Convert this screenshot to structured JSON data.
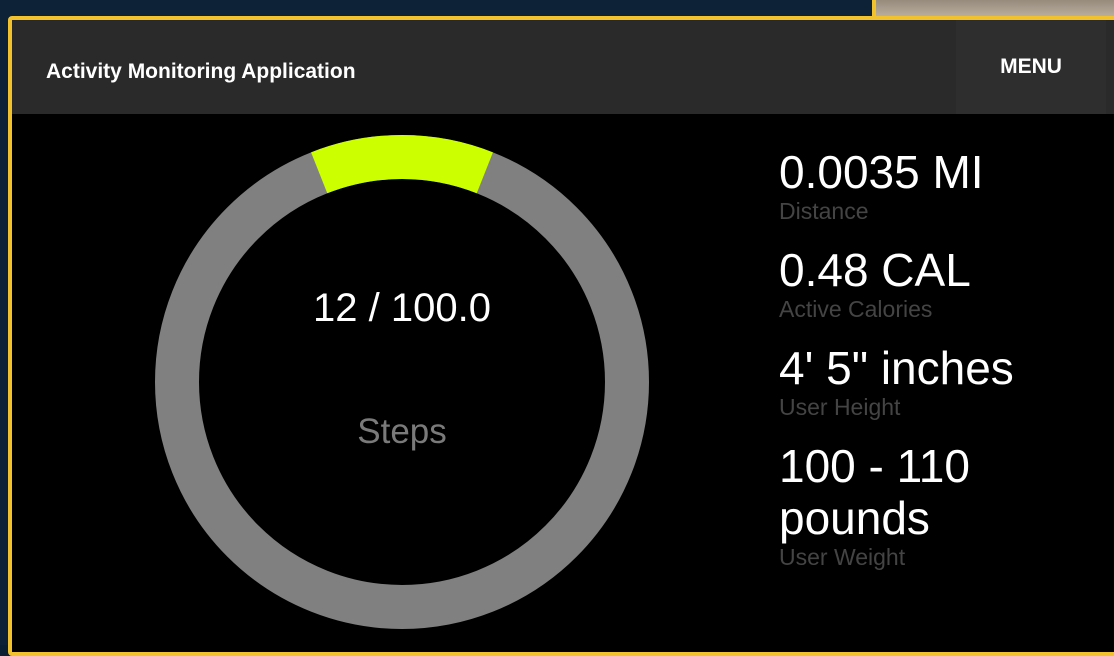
{
  "app": {
    "title": "Activity Monitoring Application",
    "menu_label": "MENU"
  },
  "steps": {
    "display": "12 / 100.0",
    "label": "Steps",
    "current": 12,
    "goal": 100.0,
    "progress_fraction": 0.12
  },
  "stats": [
    {
      "value": "0.0035 MI",
      "label": "Distance"
    },
    {
      "value": "0.48 CAL",
      "label": "Active Calories"
    },
    {
      "value": "4' 5\" inches",
      "label": "User Height"
    },
    {
      "value": "100 - 110 pounds",
      "label": "User Weight"
    }
  ],
  "colors": {
    "accent": "#ccff00",
    "ring_track": "#808080",
    "frame_border": "#f2c12e",
    "app_bar": "#2a2a2a"
  }
}
